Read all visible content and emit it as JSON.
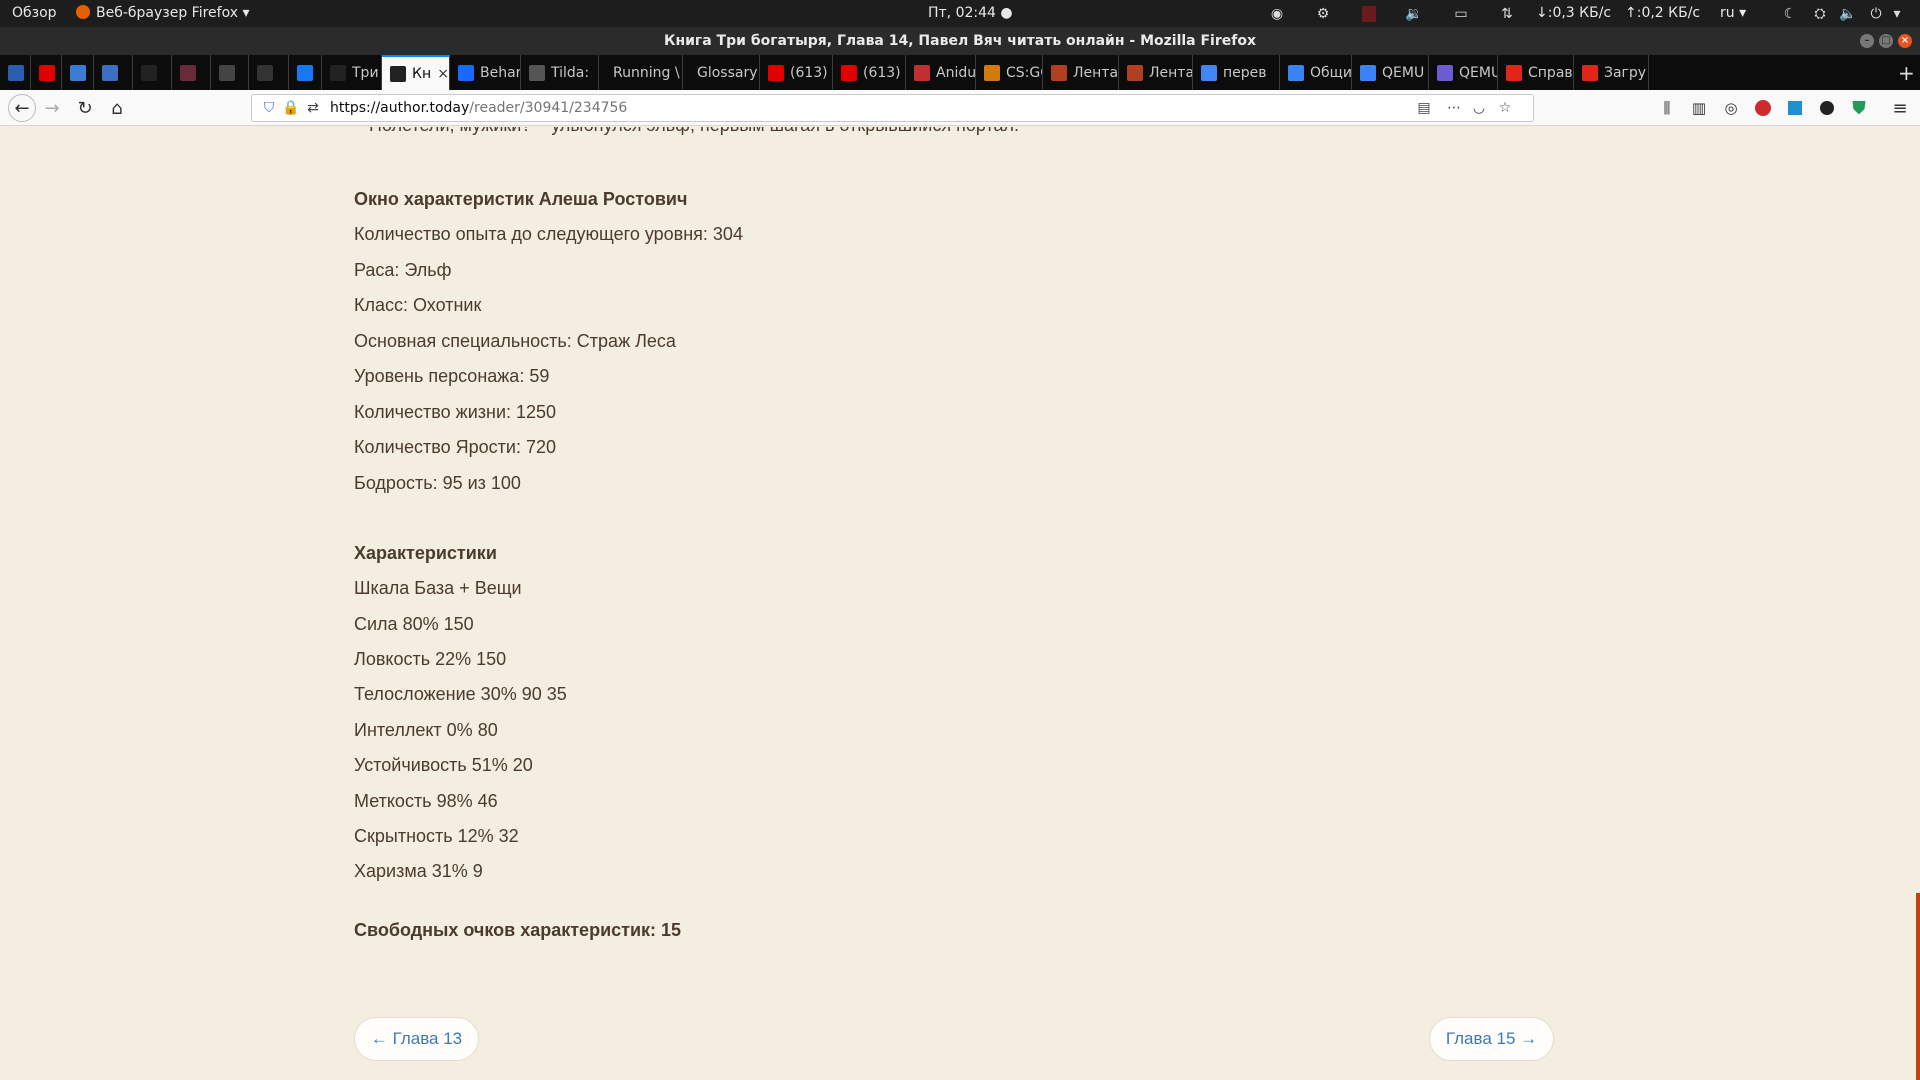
{
  "topbar": {
    "activities": "Обзор",
    "app_menu": "Веб-браузер Firefox",
    "clock": "Пт, 02:44 ●",
    "net_down": "↓:0,3 КБ/с",
    "net_up": "↑:0,2 КБ/с",
    "lang": "ru"
  },
  "window": {
    "title": "Книга Три богатыря, Глава 14, Павел Вяч читать онлайн - Mozilla Firefox"
  },
  "tabs": [
    {
      "label": "",
      "icon": "mail-icon",
      "color": "#2a5db0"
    },
    {
      "label": "",
      "icon": "youtube-icon",
      "color": "#e00000"
    },
    {
      "label": "",
      "icon": "media-icon",
      "color": "#3a7bd5"
    },
    {
      "label": "",
      "icon": "pause-icon",
      "color": "#3a6fc4"
    },
    {
      "label": "",
      "icon": "author-today-icon",
      "color": "#222"
    },
    {
      "label": "",
      "icon": "app-icon",
      "color": "#6b2a3a"
    },
    {
      "label": "",
      "icon": "checker-icon",
      "color": "#444"
    },
    {
      "label": "",
      "icon": "pen-icon",
      "color": "#333"
    },
    {
      "label": "",
      "icon": "facebook-icon",
      "color": "#1877f2"
    },
    {
      "label": "Три б",
      "icon": "author-today-icon",
      "color": "#222"
    },
    {
      "label": "Кни",
      "icon": "author-today-icon",
      "color": "#222",
      "active": true
    },
    {
      "label": "Behar",
      "icon": "behance-icon",
      "color": "#1769ff"
    },
    {
      "label": "Tilda:",
      "icon": "tilda-icon",
      "color": "#555"
    },
    {
      "label": "Running \\",
      "icon": "",
      "color": "#555"
    },
    {
      "label": "Glossary",
      "icon": "",
      "color": "#555"
    },
    {
      "label": "(613)",
      "icon": "youtube-icon",
      "color": "#e00000"
    },
    {
      "label": "(613)",
      "icon": "youtube-icon",
      "color": "#e00000"
    },
    {
      "label": "Anidu",
      "icon": "anidub-icon",
      "color": "#c03030"
    },
    {
      "label": "CS:GC",
      "icon": "csgo-icon",
      "color": "#d07a10"
    },
    {
      "label": "Лента",
      "icon": "lenta-icon",
      "color": "#b04020"
    },
    {
      "label": "Лента",
      "icon": "lenta-icon",
      "color": "#b04020"
    },
    {
      "label": "перев",
      "icon": "google-icon",
      "color": "#4285f4"
    },
    {
      "label": "Общи",
      "icon": "qemu-icon",
      "color": "#3b82f6"
    },
    {
      "label": "QEMU",
      "icon": "qemu-icon",
      "color": "#3b82f6"
    },
    {
      "label": "QEMU",
      "icon": "qemu-alt-icon",
      "color": "#6d5bd0"
    },
    {
      "label": "Справ",
      "icon": "adobe-icon",
      "color": "#e1251b"
    },
    {
      "label": "Загру",
      "icon": "adobe-icon",
      "color": "#e1251b"
    }
  ],
  "nav": {
    "url_domain": "https://author.today",
    "url_path": "/reader/30941/234756"
  },
  "content": {
    "top_cut_line": "– Полетели, мужики? – улыбнулся эльф, первым шагая в открывшийся портал.",
    "lines": [
      "Окно характеристик Алеша Ростович",
      "Количество опыта до следующего уровня: 304",
      "Раса: Эльф",
      "Класс: Охотник",
      "Основная специальность: Страж Леса",
      "Уровень персонажа: 59",
      "Количество жизни: 1250",
      "Количество Ярости: 720",
      "Бодрость: 95 из 100",
      "Характеристики",
      "Шкала База + Вещи",
      "Сила 80% 150",
      "Ловкость 22% 150",
      "Телосложение 30% 90 35",
      "Интеллект 0% 80",
      "Устойчивость 51% 20",
      "Меткость 98% 46",
      "Скрытность 12% 32",
      "Харизма 31% 9",
      "Свободных очков характеристик: 15"
    ],
    "prev_chapter": "← Глава 13",
    "next_chapter": "Глава 15 →"
  },
  "colors": {
    "page_bg": "#f4eee0",
    "text": "#4a3b2e",
    "link": "#3d7ab5",
    "scroll_accent": "#c2410c"
  }
}
